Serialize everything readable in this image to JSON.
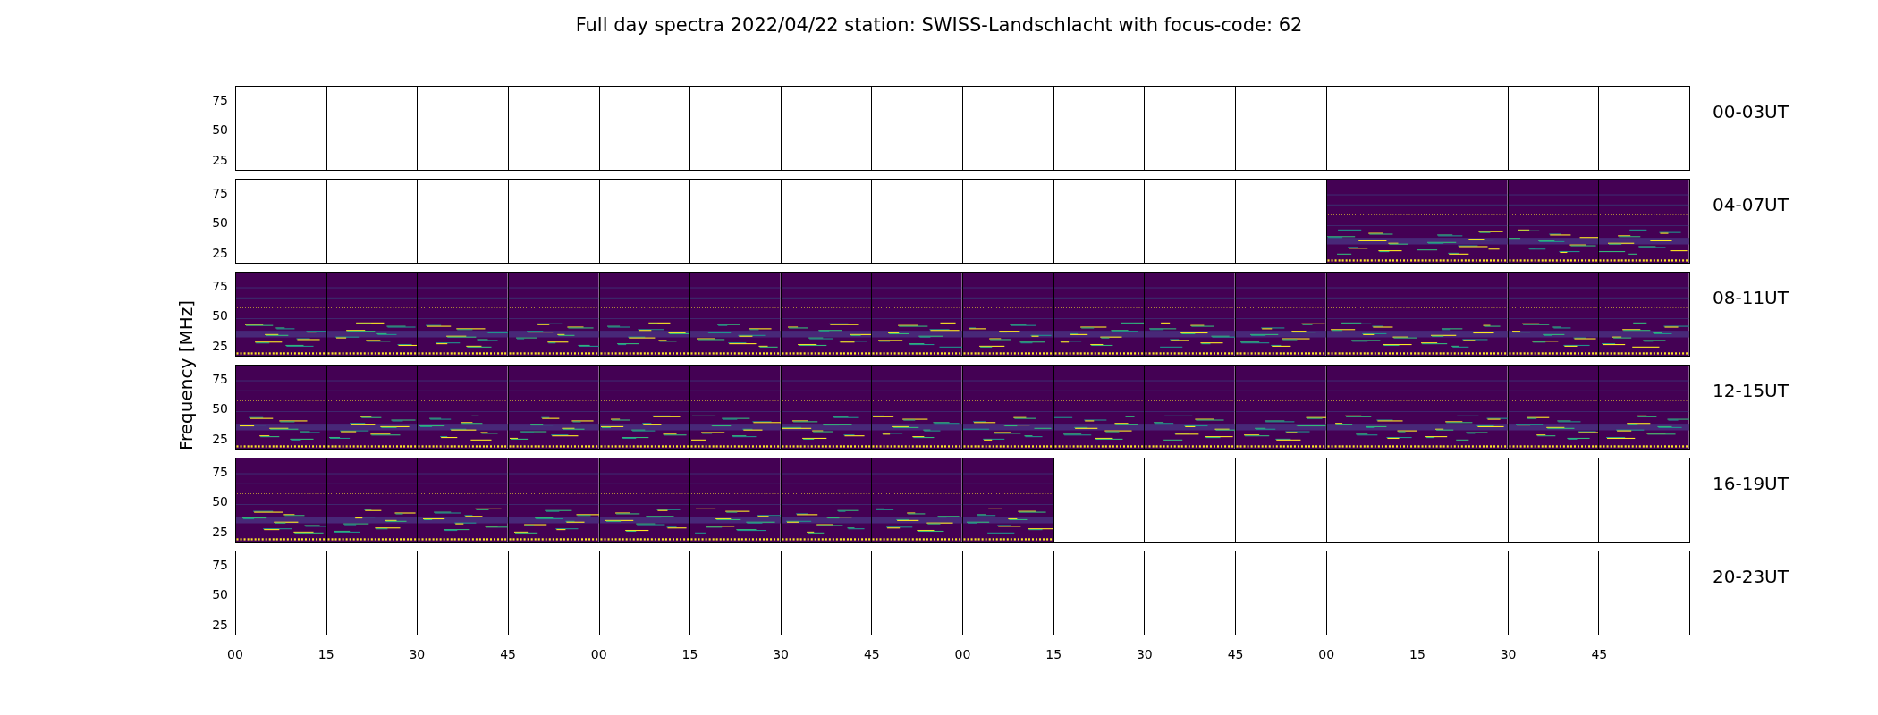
{
  "title": "Full day spectra 2022/04/22 station: SWISS-Landschlacht with focus-code: 62",
  "y_axis": {
    "label": "Frequency [MHz]"
  },
  "x_ticks": [
    "00",
    "15",
    "30",
    "45",
    "00",
    "15",
    "30",
    "45",
    "00",
    "15",
    "30",
    "45",
    "00",
    "15",
    "30",
    "45"
  ],
  "rows": [
    {
      "label": "00-03UT",
      "y_ticks": [
        "75",
        "50",
        "25"
      ],
      "panels": [
        {
          "has_data": false
        },
        {
          "has_data": false
        },
        {
          "has_data": false
        },
        {
          "has_data": false
        },
        {
          "has_data": false
        },
        {
          "has_data": false
        },
        {
          "has_data": false
        },
        {
          "has_data": false
        },
        {
          "has_data": false
        },
        {
          "has_data": false
        },
        {
          "has_data": false
        },
        {
          "has_data": false
        },
        {
          "has_data": false
        },
        {
          "has_data": false
        },
        {
          "has_data": false
        },
        {
          "has_data": false
        }
      ]
    },
    {
      "label": "04-07UT",
      "y_ticks": [
        "75",
        "50",
        "25"
      ],
      "panels": [
        {
          "has_data": false
        },
        {
          "has_data": false
        },
        {
          "has_data": false
        },
        {
          "has_data": false
        },
        {
          "has_data": false
        },
        {
          "has_data": false
        },
        {
          "has_data": false
        },
        {
          "has_data": false
        },
        {
          "has_data": false
        },
        {
          "has_data": false
        },
        {
          "has_data": false
        },
        {
          "has_data": false
        },
        {
          "has_data": true
        },
        {
          "has_data": true
        },
        {
          "has_data": true
        },
        {
          "has_data": true
        }
      ]
    },
    {
      "label": "08-11UT",
      "y_ticks": [
        "75",
        "50",
        "25"
      ],
      "panels": [
        {
          "has_data": true
        },
        {
          "has_data": true
        },
        {
          "has_data": true
        },
        {
          "has_data": true
        },
        {
          "has_data": true
        },
        {
          "has_data": true
        },
        {
          "has_data": true
        },
        {
          "has_data": true
        },
        {
          "has_data": true
        },
        {
          "has_data": true
        },
        {
          "has_data": true
        },
        {
          "has_data": true
        },
        {
          "has_data": true
        },
        {
          "has_data": true
        },
        {
          "has_data": true
        },
        {
          "has_data": true
        }
      ]
    },
    {
      "label": "12-15UT",
      "y_ticks": [
        "75",
        "50",
        "25"
      ],
      "panels": [
        {
          "has_data": true
        },
        {
          "has_data": true
        },
        {
          "has_data": true
        },
        {
          "has_data": true
        },
        {
          "has_data": true
        },
        {
          "has_data": true
        },
        {
          "has_data": true
        },
        {
          "has_data": true
        },
        {
          "has_data": true
        },
        {
          "has_data": true
        },
        {
          "has_data": true
        },
        {
          "has_data": true
        },
        {
          "has_data": true
        },
        {
          "has_data": true
        },
        {
          "has_data": true
        },
        {
          "has_data": true
        }
      ]
    },
    {
      "label": "16-19UT",
      "y_ticks": [
        "75",
        "50",
        "25"
      ],
      "panels": [
        {
          "has_data": true
        },
        {
          "has_data": true
        },
        {
          "has_data": true
        },
        {
          "has_data": true
        },
        {
          "has_data": true
        },
        {
          "has_data": true
        },
        {
          "has_data": true
        },
        {
          "has_data": true
        },
        {
          "has_data": true
        },
        {
          "has_data": false
        },
        {
          "has_data": false
        },
        {
          "has_data": false
        },
        {
          "has_data": false
        },
        {
          "has_data": false
        },
        {
          "has_data": false
        },
        {
          "has_data": false
        }
      ]
    },
    {
      "label": "20-23UT",
      "y_ticks": [
        "75",
        "50",
        "25"
      ],
      "panels": [
        {
          "has_data": false
        },
        {
          "has_data": false
        },
        {
          "has_data": false
        },
        {
          "has_data": false
        },
        {
          "has_data": false
        },
        {
          "has_data": false
        },
        {
          "has_data": false
        },
        {
          "has_data": false
        },
        {
          "has_data": false
        },
        {
          "has_data": false
        },
        {
          "has_data": false
        },
        {
          "has_data": false
        },
        {
          "has_data": false
        },
        {
          "has_data": false
        },
        {
          "has_data": false
        },
        {
          "has_data": false
        }
      ]
    }
  ]
}
